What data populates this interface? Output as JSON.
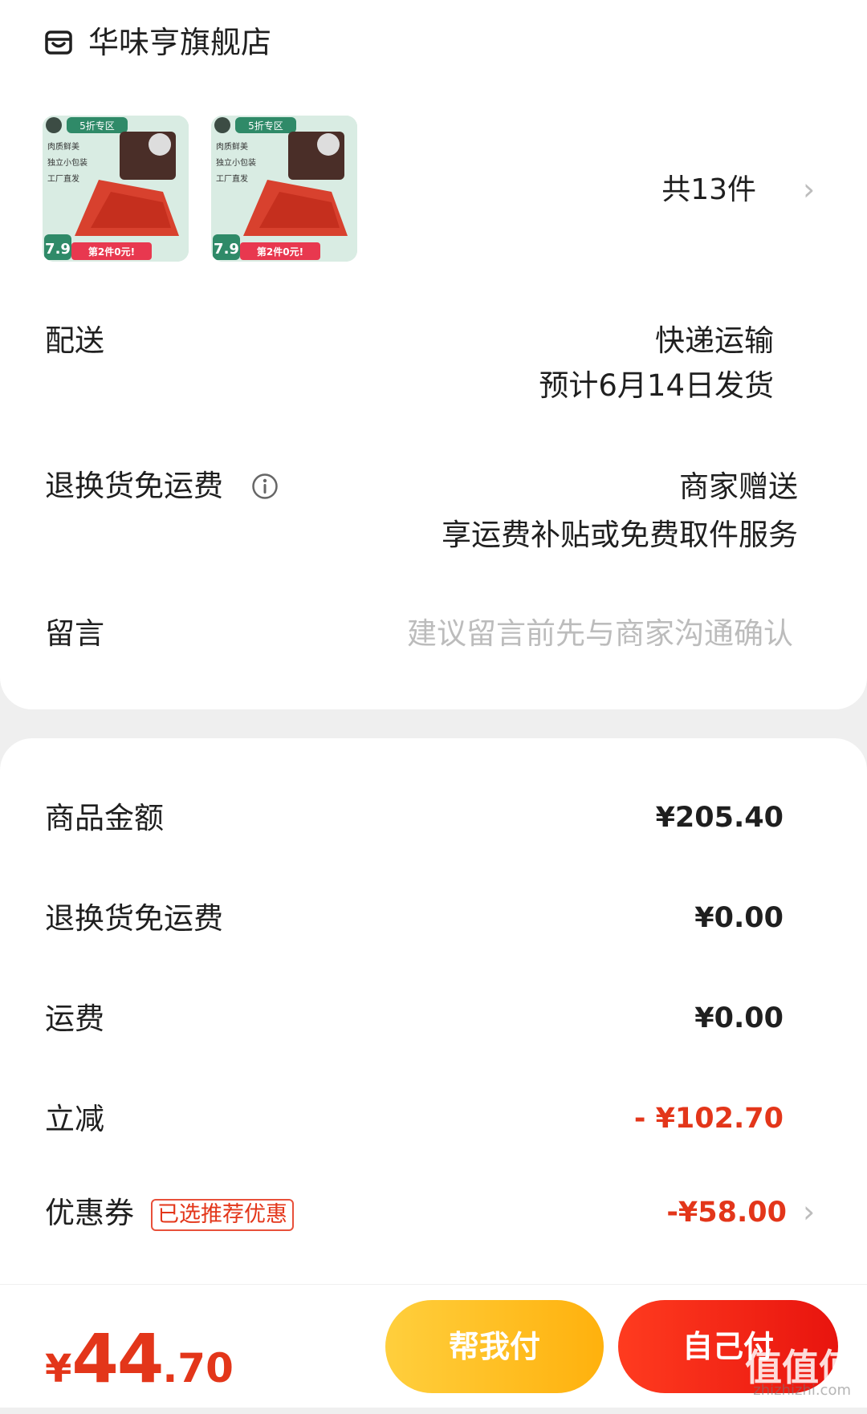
{
  "store": {
    "name": "华味亨旗舰店",
    "icon": "store-icon"
  },
  "products": {
    "thumbnails": [
      {
        "tag": "5折专区",
        "lines": [
          "肉质鲜美",
          "独立小包装",
          "工厂直发"
        ],
        "price": "7.9",
        "promo": "第2件0元!"
      },
      {
        "tag": "5折专区",
        "lines": [
          "肉质鲜美",
          "独立小包装",
          "工厂直发"
        ],
        "price": "7.9",
        "promo": "第2件0元!"
      }
    ],
    "count_label": "共13件"
  },
  "delivery": {
    "label": "配送",
    "method": "快递运输",
    "eta": "预计6月14日发货"
  },
  "return_shipping": {
    "label": "退换货免运费",
    "value": "商家赠送",
    "desc": "享运费补贴或免费取件服务"
  },
  "message": {
    "label": "留言",
    "placeholder": "建议留言前先与商家沟通确认"
  },
  "summary": {
    "goods_label": "商品金额",
    "goods_value": "¥205.40",
    "return_label": "退换货免运费",
    "return_value": "¥0.00",
    "shipping_label": "运费",
    "shipping_value": "¥0.00",
    "discount_label": "立减",
    "discount_value": "- ¥102.70",
    "coupon_label": "优惠券",
    "coupon_badge": "已选推荐优惠",
    "coupon_value": "-¥58.00"
  },
  "footer": {
    "currency": "¥",
    "total_int": "44",
    "total_dec": ".70",
    "help_pay_label": "帮我付",
    "self_pay_label": "自己付"
  },
  "watermark": {
    "main": "值值值",
    "sub": "zhizhizhi.com"
  },
  "colors": {
    "accent_red": "#e3361a",
    "help_yellow": "#ffbf1f",
    "pay_red": "#f02a16"
  }
}
